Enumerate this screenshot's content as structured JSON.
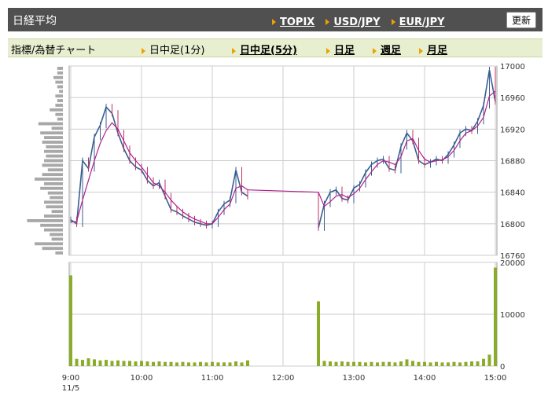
{
  "header": {
    "title": "日経平均",
    "links": [
      "TOPIX",
      "USD/JPY",
      "EUR/JPY"
    ],
    "refresh_label": "更新"
  },
  "subbar": {
    "title": "指標/為替チャート",
    "tabs": [
      {
        "label": "日中足(1分)",
        "active": false
      },
      {
        "label": "日中足(5分)",
        "active": true
      },
      {
        "label": "日足",
        "active": false
      },
      {
        "label": "週足",
        "active": false
      },
      {
        "label": "月足",
        "active": false
      }
    ]
  },
  "colors": {
    "candle_up": "#3a5f8f",
    "candle_down": "#c03060",
    "moving_average": "#b02090",
    "volume_bar": "#8bac2a",
    "volume_profile": "#a8a8a8",
    "grid": "#cccccc"
  },
  "chart_data": {
    "type": "line",
    "x_ticks": [
      "9:00",
      "10:00",
      "11:00",
      "12:00",
      "13:00",
      "14:00",
      "15:00"
    ],
    "date_label": "11/5",
    "price_axis": {
      "ticks": [
        16760,
        16800,
        16840,
        16880,
        16920,
        16960,
        17000
      ],
      "ylim": [
        16760,
        17000
      ]
    },
    "volume_axis": {
      "ticks": [
        0,
        10000,
        20000
      ],
      "ylim": [
        0,
        20000
      ]
    },
    "series": [
      {
        "kind": "price",
        "x": [
          "9:00",
          "9:05",
          "9:10",
          "9:15",
          "9:20",
          "9:25",
          "9:30",
          "9:35",
          "9:40",
          "9:45",
          "9:50",
          "9:55",
          "10:00",
          "10:05",
          "10:10",
          "10:15",
          "10:20",
          "10:25",
          "10:30",
          "10:35",
          "10:40",
          "10:45",
          "10:50",
          "10:55",
          "11:00",
          "11:05",
          "11:10",
          "11:15",
          "11:20",
          "11:25",
          "11:30",
          "12:30",
          "12:35",
          "12:40",
          "12:45",
          "12:50",
          "12:55",
          "13:00",
          "13:05",
          "13:10",
          "13:15",
          "13:20",
          "13:25",
          "13:30",
          "13:35",
          "13:40",
          "13:45",
          "13:50",
          "13:55",
          "14:00",
          "14:05",
          "14:10",
          "14:15",
          "14:20",
          "14:25",
          "14:30",
          "14:35",
          "14:40",
          "14:45",
          "14:50",
          "14:55",
          "15:00"
        ],
        "values": [
          16805,
          16800,
          16880,
          16870,
          16910,
          16925,
          16948,
          16940,
          16915,
          16895,
          16880,
          16872,
          16868,
          16855,
          16848,
          16852,
          16835,
          16818,
          16815,
          16810,
          16806,
          16802,
          16800,
          16798,
          16800,
          16815,
          16825,
          16830,
          16868,
          16840,
          16835,
          16795,
          16825,
          16840,
          16843,
          16832,
          16830,
          16845,
          16850,
          16865,
          16875,
          16880,
          16882,
          16870,
          16868,
          16898,
          16915,
          16905,
          16880,
          16875,
          16878,
          16882,
          16880,
          16888,
          16900,
          16915,
          16920,
          16918,
          16930,
          16950,
          16995,
          16955
        ]
      },
      {
        "kind": "moving_average",
        "x": [
          "9:00",
          "9:05",
          "9:10",
          "9:15",
          "9:20",
          "9:25",
          "9:30",
          "9:35",
          "9:40",
          "9:45",
          "9:50",
          "9:55",
          "10:00",
          "10:05",
          "10:10",
          "10:15",
          "10:20",
          "10:25",
          "10:30",
          "10:35",
          "10:40",
          "10:45",
          "10:50",
          "10:55",
          "11:00",
          "11:05",
          "11:10",
          "11:15",
          "11:20",
          "11:25",
          "11:30",
          "12:30",
          "12:35",
          "12:40",
          "12:45",
          "12:50",
          "12:55",
          "13:00",
          "13:05",
          "13:10",
          "13:15",
          "13:20",
          "13:25",
          "13:30",
          "13:35",
          "13:40",
          "13:45",
          "13:50",
          "13:55",
          "14:00",
          "14:05",
          "14:10",
          "14:15",
          "14:20",
          "14:25",
          "14:30",
          "14:35",
          "14:40",
          "14:45",
          "14:50",
          "14:55",
          "15:00"
        ],
        "values": [
          16802,
          16803,
          16830,
          16855,
          16880,
          16902,
          16918,
          16928,
          16920,
          16905,
          16890,
          16880,
          16872,
          16862,
          16852,
          16848,
          16840,
          16830,
          16822,
          16815,
          16810,
          16806,
          16803,
          16800,
          16800,
          16808,
          16818,
          16825,
          16845,
          16848,
          16843,
          16840,
          16822,
          16828,
          16835,
          16837,
          16833,
          16838,
          16845,
          16856,
          16866,
          16875,
          16880,
          16878,
          16875,
          16885,
          16905,
          16908,
          16893,
          16882,
          16878,
          16880,
          16881,
          16885,
          16893,
          16905,
          16915,
          16918,
          16924,
          16935,
          16962,
          16968
        ]
      },
      {
        "kind": "volume",
        "x": [
          "9:00",
          "9:05",
          "9:10",
          "9:15",
          "9:20",
          "9:25",
          "9:30",
          "9:35",
          "9:40",
          "9:45",
          "9:50",
          "9:55",
          "10:00",
          "10:05",
          "10:10",
          "10:15",
          "10:20",
          "10:25",
          "10:30",
          "10:35",
          "10:40",
          "10:45",
          "10:50",
          "10:55",
          "11:00",
          "11:05",
          "11:10",
          "11:15",
          "11:20",
          "11:25",
          "11:30",
          "12:30",
          "12:35",
          "12:40",
          "12:45",
          "12:50",
          "12:55",
          "13:00",
          "13:05",
          "13:10",
          "13:15",
          "13:20",
          "13:25",
          "13:30",
          "13:35",
          "13:40",
          "13:45",
          "13:50",
          "13:55",
          "14:00",
          "14:05",
          "14:10",
          "14:15",
          "14:20",
          "14:25",
          "14:30",
          "14:35",
          "14:40",
          "14:45",
          "14:50",
          "14:55",
          "15:00"
        ],
        "values": [
          17500,
          1400,
          1200,
          1500,
          1300,
          1100,
          1200,
          1000,
          1100,
          1000,
          1000,
          900,
          1000,
          900,
          800,
          900,
          800,
          800,
          700,
          800,
          700,
          700,
          800,
          700,
          800,
          700,
          700,
          700,
          900,
          700,
          1100,
          12500,
          1000,
          900,
          800,
          900,
          800,
          800,
          800,
          700,
          800,
          700,
          800,
          800,
          700,
          900,
          1300,
          1000,
          800,
          800,
          700,
          800,
          700,
          700,
          800,
          700,
          800,
          900,
          900,
          1400,
          2200,
          19000
        ]
      }
    ],
    "volume_profile": [
      0.15,
      0.15,
      0.25,
      0.2,
      0.15,
      0.1,
      0.2,
      0.15,
      0.2,
      0.35,
      0.2,
      0.15,
      0.65,
      0.3,
      0.6,
      0.5,
      0.55,
      0.45,
      0.5,
      0.45,
      0.5,
      0.55,
      0.4,
      0.55,
      0.75,
      0.5,
      0.6,
      0.4,
      0.35,
      0.5,
      0.45,
      0.3,
      0.5,
      0.95,
      0.6,
      0.5,
      0.35,
      0.3,
      0.75,
      0.55,
      0.2
    ]
  }
}
